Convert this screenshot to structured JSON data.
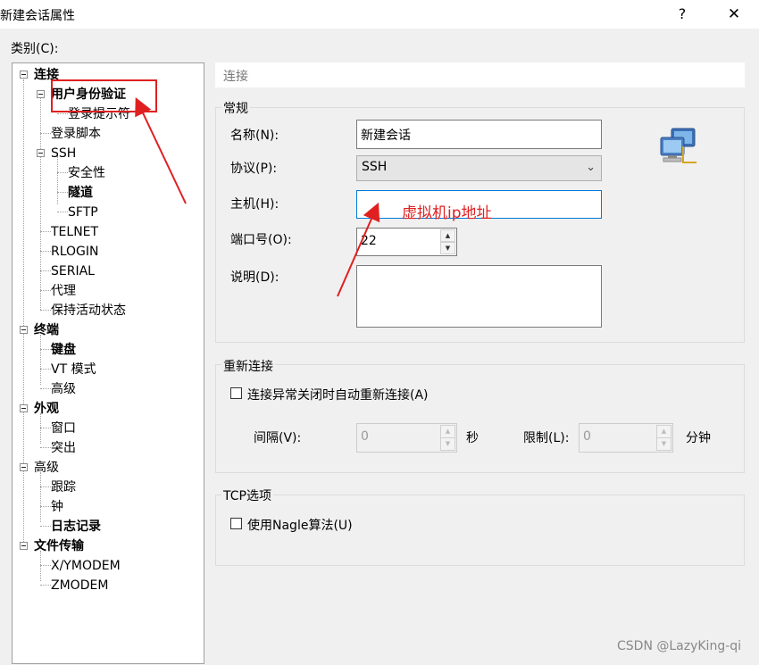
{
  "window": {
    "title": "新建会话属性",
    "help_label": "?",
    "close_label": "✕"
  },
  "category_label": "类别(C):",
  "tree": {
    "items": [
      {
        "label": "连接",
        "bold": true
      },
      {
        "label": "用户身份验证",
        "bold": true
      },
      {
        "label": "登录提示符",
        "bold": false
      },
      {
        "label": "登录脚本",
        "bold": false
      },
      {
        "label": "SSH",
        "bold": false
      },
      {
        "label": "安全性",
        "bold": false
      },
      {
        "label": "隧道",
        "bold": true
      },
      {
        "label": "SFTP",
        "bold": false
      },
      {
        "label": "TELNET",
        "bold": false
      },
      {
        "label": "RLOGIN",
        "bold": false
      },
      {
        "label": "SERIAL",
        "bold": false
      },
      {
        "label": "代理",
        "bold": false
      },
      {
        "label": "保持活动状态",
        "bold": false
      },
      {
        "label": "终端",
        "bold": true
      },
      {
        "label": "键盘",
        "bold": true
      },
      {
        "label": "VT 模式",
        "bold": false
      },
      {
        "label": "高级",
        "bold": false
      },
      {
        "label": "外观",
        "bold": true
      },
      {
        "label": "窗口",
        "bold": false
      },
      {
        "label": "突出",
        "bold": false
      },
      {
        "label": "高级",
        "bold": false
      },
      {
        "label": "跟踪",
        "bold": false
      },
      {
        "label": "钟",
        "bold": false
      },
      {
        "label": "日志记录",
        "bold": true
      },
      {
        "label": "文件传输",
        "bold": true
      },
      {
        "label": "X/YMODEM",
        "bold": false
      },
      {
        "label": "ZMODEM",
        "bold": false
      }
    ]
  },
  "panel": {
    "header": "连接",
    "general": {
      "title": "常规",
      "name_label": "名称(N):",
      "name_value": "新建会话",
      "protocol_label": "协议(P):",
      "protocol_value": "SSH",
      "host_label": "主机(H):",
      "host_value": "",
      "port_label": "端口号(O):",
      "port_value": "22",
      "desc_label": "说明(D):",
      "desc_value": ""
    },
    "reconnect": {
      "title": "重新连接",
      "auto_reconnect_label": "连接异常关闭时自动重新连接(A)",
      "auto_reconnect_checked": false,
      "interval_label": "间隔(V):",
      "interval_value": "0",
      "interval_unit": "秒",
      "limit_label": "限制(L):",
      "limit_value": "0",
      "limit_unit": "分钟"
    },
    "tcp": {
      "title": "TCP选项",
      "nagle_label": "使用Nagle算法(U)",
      "nagle_checked": false
    }
  },
  "annotation": {
    "host_note": "虚拟机ip地址",
    "color": "#e02020"
  },
  "watermark": "CSDN @LazyKing-qi"
}
